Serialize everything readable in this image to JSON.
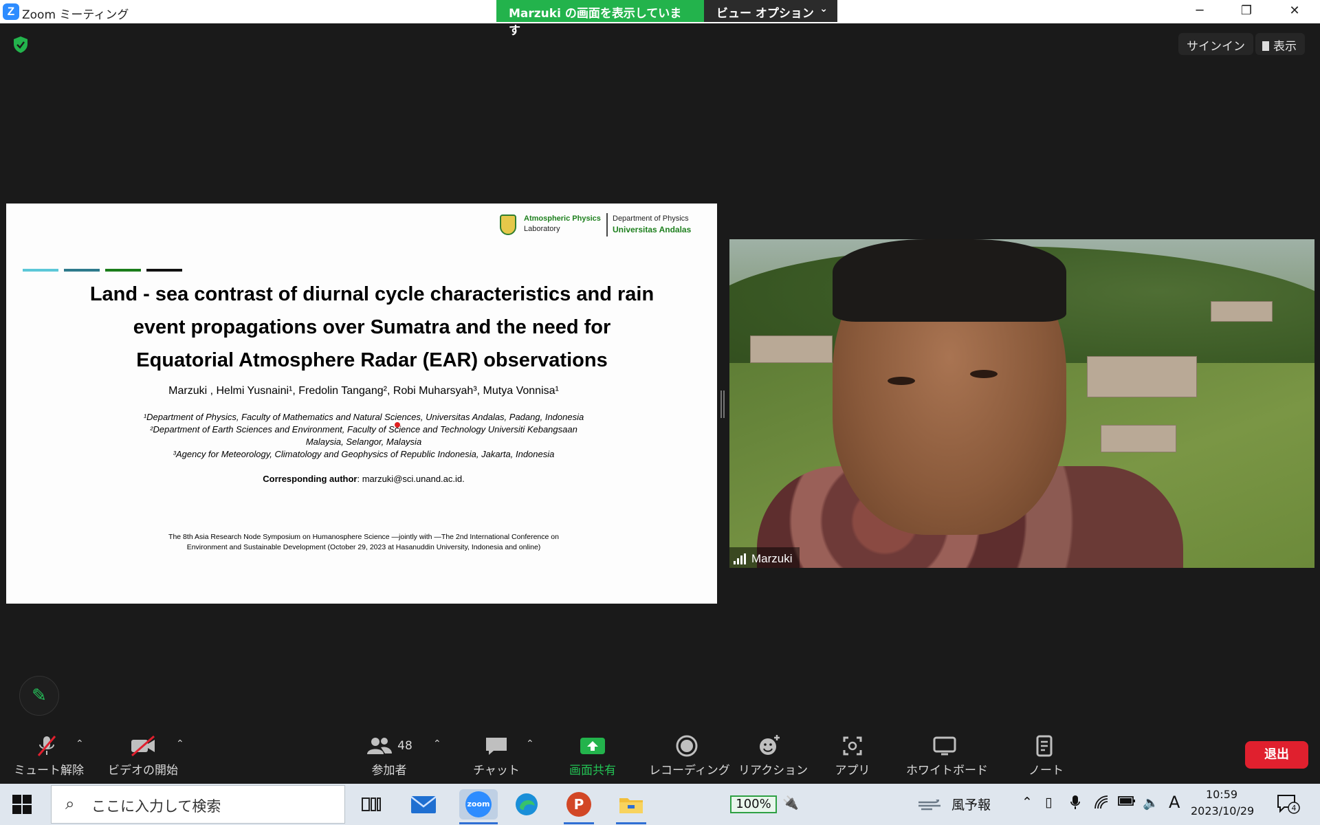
{
  "window": {
    "logo_letter": "Z",
    "title": "Zoom ミーティング",
    "share_banner": "Marzuki の画面を表示しています",
    "view_options": "ビュー オプション",
    "controls": [
      "─",
      "❐",
      "✕"
    ]
  },
  "top_right": {
    "sign_in": "サインイン",
    "view": "表示"
  },
  "slide": {
    "logo": {
      "lab_line1": "Atmospheric Physics",
      "lab_line2": "Laboratory",
      "dept_line1": "Department of Physics",
      "dept_line2": "Universitas Andalas"
    },
    "accent_colors": [
      "#5cc8d8",
      "#2e7a8c",
      "#1b7d1b",
      "#111111"
    ],
    "title_lines": [
      "Land - sea contrast of diurnal cycle characteristics and rain",
      "event propagations over Sumatra and the need for",
      "Equatorial Atmosphere Radar (EAR) observations"
    ],
    "authors": "Marzuki , Helmi Yusnaini¹, Fredolin Tangang², Robi Muharsyah³, Mutya Vonnisa¹",
    "affiliations": [
      "¹Department of Physics, Faculty of Mathematics and Natural Sciences, Universitas Andalas, Padang, Indonesia",
      "²Department of Earth Sciences and Environment, Faculty of Science and Technology Universiti Kebangsaan",
      "Malaysia, Selangor, Malaysia",
      "³Agency for Meteorology, Climatology and Geophysics of Republic Indonesia, Jakarta, Indonesia"
    ],
    "corresponding_label": "Corresponding author",
    "corresponding_value": ": marzuki@sci.unand.ac.id.",
    "conference_lines": [
      "The 8th Asia Research Node Symposium on Humanosphere Science —jointly with —The 2nd International Conference on",
      "Environment and Sustainable Development (October 29, 2023 at Hasanuddin University, Indonesia and online)"
    ]
  },
  "video": {
    "participant_name": "Marzuki"
  },
  "toolbar": {
    "mute": "ミュート解除",
    "video": "ビデオの開始",
    "participants": "参加者",
    "participant_count": "48",
    "chat": "チャット",
    "share": "画面共有",
    "record": "レコーディング",
    "reactions": "リアクション",
    "apps": "アプリ",
    "whiteboard": "ホワイトボード",
    "notes": "ノート",
    "leave": "退出",
    "caret": "⌃"
  },
  "taskbar": {
    "search_placeholder": "ここに入力して検索",
    "zoom_label": "zoom",
    "ppt_label": "P",
    "battery_percent": "100%",
    "weather": "風予報",
    "ime": "A",
    "time": "10:59",
    "date": "2023/10/29",
    "notifications": "4"
  },
  "colors": {
    "zoom_blue": "#2d8cff",
    "share_green": "#23b34c",
    "leave_red": "#e0202e"
  }
}
